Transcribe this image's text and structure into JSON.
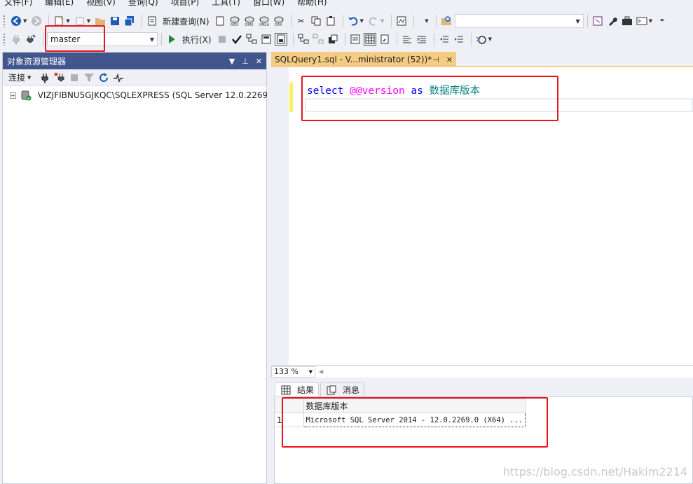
{
  "menubar": {
    "items": [
      "文件(F)",
      "编辑(E)",
      "视图(V)",
      "查询(Q)",
      "项目(P)",
      "工具(T)",
      "窗口(W)",
      "帮助(H)"
    ]
  },
  "toolbar": {
    "new_query_label": "新建查询(N)",
    "execute_label": "执行(X)",
    "database_value": "master",
    "search_value": ""
  },
  "object_explorer": {
    "title": "对象资源管理器",
    "connect_label": "连接",
    "server_node": "VIZJFIBNU5GJKQC\\SQLEXPRESS (SQL Server 12.0.2269 -"
  },
  "editor": {
    "tab_title": "SQLQuery1.sql - V...ministrator (52))*",
    "code": {
      "kw1": "select",
      "var": "@@version",
      "kw2": "as",
      "alias": "数据库版本"
    },
    "zoom": "133 %"
  },
  "results": {
    "tabs": [
      "结果",
      "消息"
    ],
    "column": "数据库版本",
    "rows": [
      {
        "num": "1",
        "value": "Microsoft SQL Server 2014 - 12.0.2269.0 (X64)  ..."
      }
    ]
  },
  "watermark": "https://blog.csdn.net/Hakim2214",
  "colors": {
    "accent_tab": "#f5cc84",
    "panel_title": "#40568d",
    "highlight": "#e8141e"
  }
}
